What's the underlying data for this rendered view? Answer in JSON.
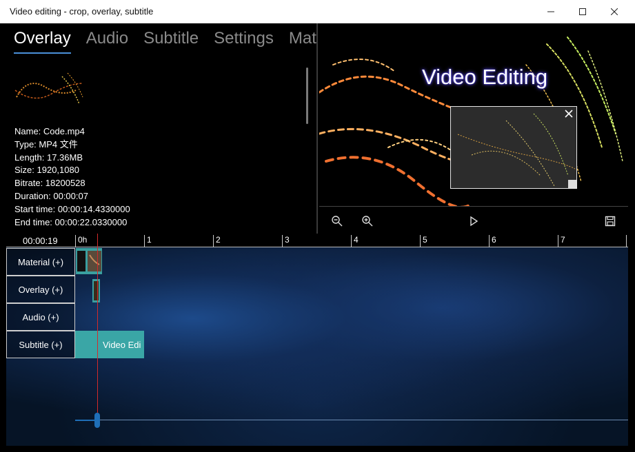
{
  "window": {
    "title": "Video editing - crop, overlay, subtitle",
    "minimize_icon": "minimize-icon",
    "maximize_icon": "maximize-icon",
    "close_icon": "close-icon"
  },
  "tabs": [
    {
      "label": "Overlay",
      "active": true
    },
    {
      "label": "Audio",
      "active": false
    },
    {
      "label": "Subtitle",
      "active": false
    },
    {
      "label": "Settings",
      "active": false
    },
    {
      "label": "Mate",
      "active": false
    }
  ],
  "file_info": {
    "name": "Name: Code.mp4",
    "type": "Type: MP4 文件",
    "length": "Length: 17.36MB",
    "size": "Size: 1920,1080",
    "bitrate": "Bitrate: 18200528",
    "duration": "Duration: 00:00:07",
    "start_time": "Start time: 00:00:14.4330000",
    "end_time": "End time: 00:00:22.0330000"
  },
  "preview": {
    "overlay_text": "Video Editing",
    "controls": [
      "zoom-out-icon",
      "zoom-in-icon",
      "play-icon",
      "save-icon"
    ]
  },
  "timeline": {
    "current_time": "00:00:19",
    "ruler_ticks": [
      "0h",
      "1",
      "2",
      "3",
      "4",
      "5",
      "6",
      "7"
    ],
    "tracks": [
      {
        "label": "Material (+)"
      },
      {
        "label": "Overlay (+)"
      },
      {
        "label": "Audio (+)"
      },
      {
        "label": "Subtitle (+)"
      }
    ],
    "subtitle_clip_text": "Video Edi"
  },
  "colors": {
    "accent": "#4a90d9",
    "clip": "#4bb0b0",
    "playhead": "#d32a2a"
  }
}
